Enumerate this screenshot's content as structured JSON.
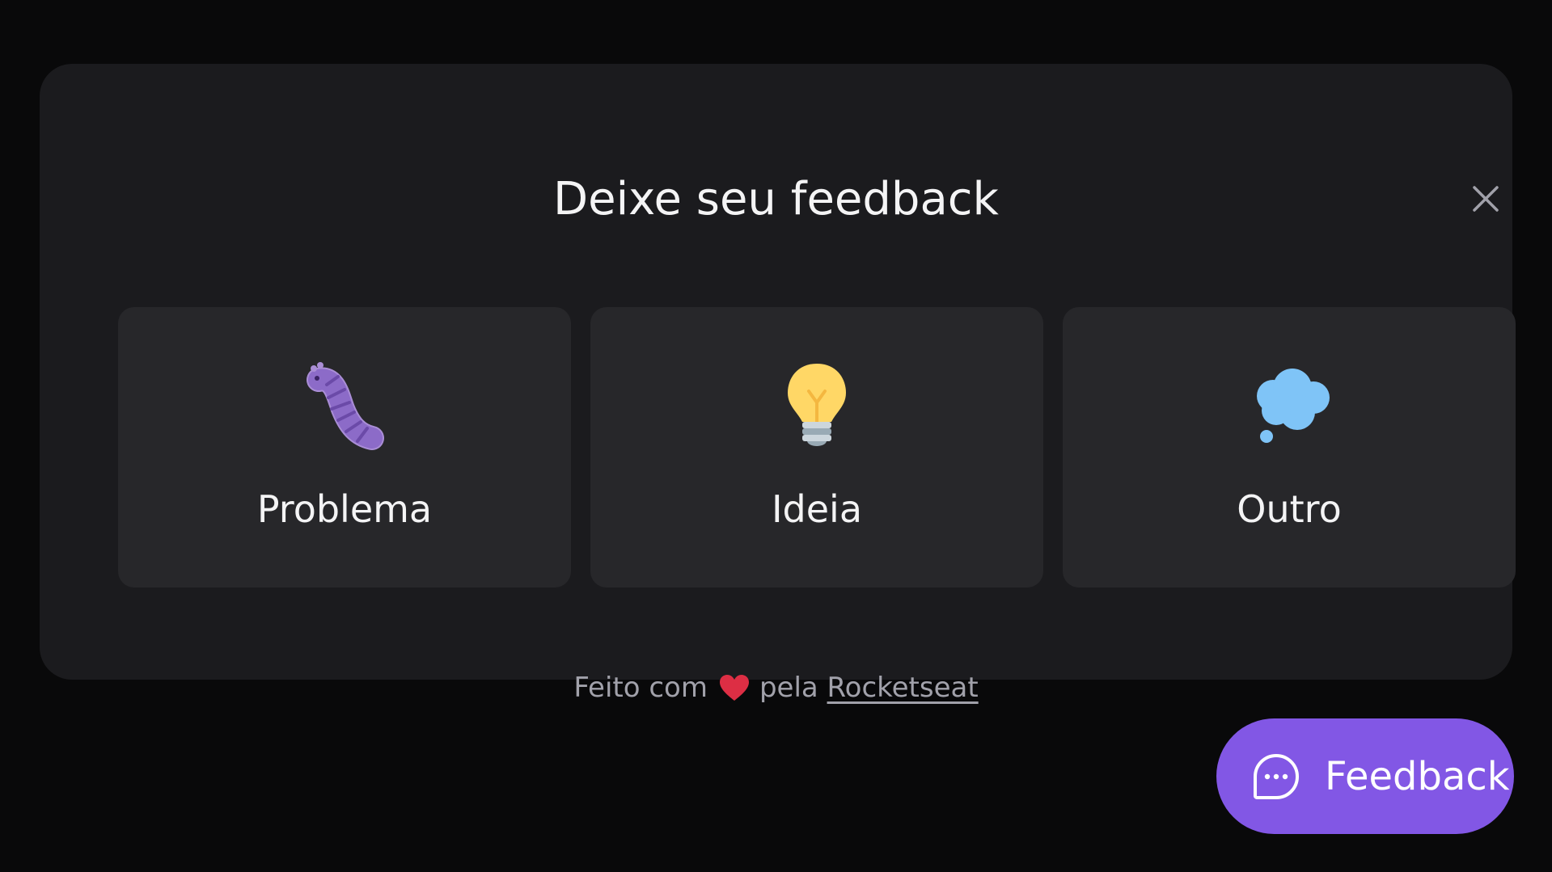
{
  "widget": {
    "title": "Deixe seu feedback",
    "close_icon": "close-icon",
    "options": [
      {
        "label": "Problema",
        "icon": "bug-icon"
      },
      {
        "label": "Ideia",
        "icon": "lightbulb-icon"
      },
      {
        "label": "Outro",
        "icon": "thought-balloon-icon"
      }
    ],
    "footer": {
      "prefix": "Feito com",
      "heart_icon": "heart-icon",
      "middle": "pela",
      "link": "Rocketseat"
    }
  },
  "fab": {
    "label": "Feedback",
    "icon": "chat-icon"
  },
  "colors": {
    "background": "#09090a",
    "panel": "#1b1b1e",
    "card": "#27272a",
    "brand": "#8257e5",
    "text": "#f4f4f5",
    "muted": "#a1a1aa"
  }
}
